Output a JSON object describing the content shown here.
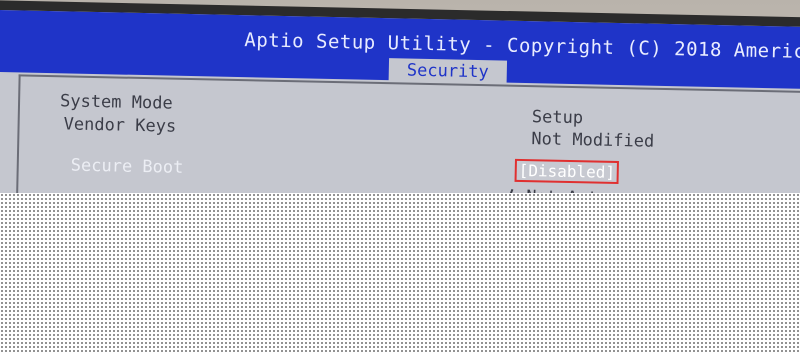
{
  "bios": {
    "title": "Aptio Setup Utility - Copyright (C) 2018 Americ",
    "active_tab": "Security",
    "rows": [
      {
        "label": "System Mode",
        "value": "Setup"
      },
      {
        "label": "Vendor Keys",
        "value": "Not Modified"
      },
      {
        "label": "Secure Boot",
        "value": "[Disabled]"
      },
      {
        "label": "",
        "value": "Not Act"
      }
    ]
  },
  "colors": {
    "title_bar": "#1f34c8",
    "screen_bg": "#c5c7cf",
    "highlight_border": "#e03030"
  }
}
